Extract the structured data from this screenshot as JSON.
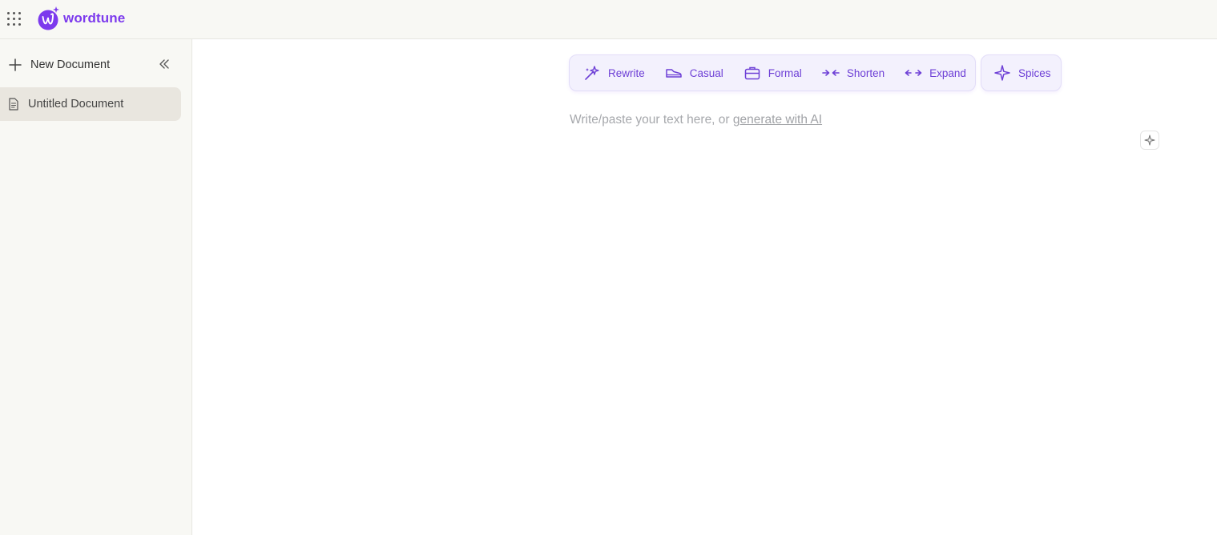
{
  "app": {
    "brand": "wordtune",
    "brand_color": "#7c3aed"
  },
  "header": {
    "apps_icon": "apps-grid-icon"
  },
  "sidebar": {
    "new_document_label": "New Document",
    "documents": [
      {
        "title": "Untitled Document",
        "selected": true
      }
    ]
  },
  "toolbar": {
    "tools": [
      {
        "label": "Rewrite",
        "icon": "sparkle-pen-icon"
      },
      {
        "label": "Casual",
        "icon": "sneaker-icon"
      },
      {
        "label": "Formal",
        "icon": "briefcase-icon"
      },
      {
        "label": "Shorten",
        "icon": "arrows-inward-icon"
      },
      {
        "label": "Expand",
        "icon": "arrows-outward-icon"
      }
    ],
    "spices_label": "Spices"
  },
  "editor": {
    "placeholder_prefix": "Write/paste your text here, or ",
    "generate_link": "generate with AI"
  },
  "colors": {
    "accent": "#6d3fd6",
    "toolbar_bg": "#f3f1fd",
    "sidebar_bg": "#f8f8f4",
    "selected_bg": "#e9e6df"
  }
}
